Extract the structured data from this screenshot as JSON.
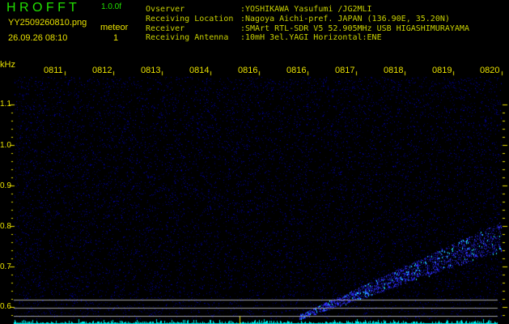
{
  "header": {
    "app_title": "H R O F F T",
    "version": "1.0.0f",
    "filename": "YY2509260810.png",
    "mode": "meteor",
    "datetime": "26.09.26 08:10",
    "count": "1"
  },
  "info": [
    {
      "label": "Ovserver",
      "value": ":YOSHIKAWA Yasufumi /JG2MLI"
    },
    {
      "label": "Receiving Location",
      "value": ":Nagoya Aichi-pref. JAPAN (136.90E, 35.20N)"
    },
    {
      "label": "Receiver",
      "value": ":SMArt RTL-SDR V5 52.905MHz USB HIGASHIMURAYAMA"
    },
    {
      "label": "Receiving Antenna",
      "value": ":10mH 3el.YAGI Horizontal:ENE"
    }
  ],
  "axis": {
    "unit": "kHz",
    "time_ticks": [
      "0811",
      "0812",
      "0813",
      "0814",
      "0816",
      "0816",
      "0817",
      "0818",
      "0819",
      "0820"
    ],
    "freq_ticks": [
      "1.1",
      "1.0",
      "0.9",
      "0.8",
      "0.7",
      "0.6"
    ]
  },
  "colors": {
    "background": "#000000",
    "noise": "#1a1ad0",
    "signal": "#00ffff",
    "marker": "#a0a0a0"
  }
}
